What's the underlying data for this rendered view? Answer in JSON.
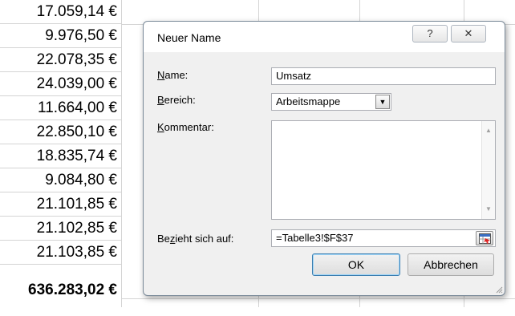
{
  "spreadsheet": {
    "values": [
      "17.059,14 €",
      "9.976,50 €",
      "22.078,35 €",
      "24.039,00 €",
      "11.664,00 €",
      "22.850,10 €",
      "18.835,74 €",
      "9.084,80 €",
      "21.101,85 €",
      "21.102,85 €",
      "21.103,85 €"
    ],
    "total": "636.283,02 €"
  },
  "dialog": {
    "title": "Neuer Name",
    "help_label": "?",
    "close_label": "✕",
    "name_label_hotkey": "N",
    "name_label_rest": "ame:",
    "name_value": "Umsatz",
    "scope_label_hotkey": "B",
    "scope_label_rest": "ereich:",
    "scope_value": "Arbeitsmappe",
    "comment_label_hotkey": "K",
    "comment_label_rest": "ommentar:",
    "comment_value": "",
    "refers_label_pre": "Be",
    "refers_label_hotkey": "z",
    "refers_label_post": "ieht sich auf:",
    "refers_value": "=Tabelle3!$F$37",
    "ok_label": "OK",
    "cancel_label": "Abbrechen"
  }
}
